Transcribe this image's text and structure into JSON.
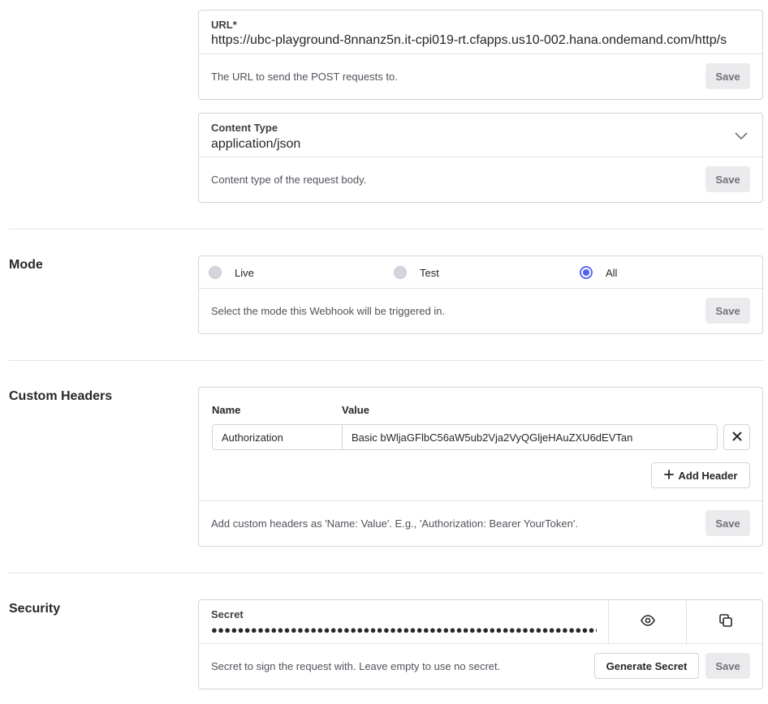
{
  "url": {
    "label": "URL*",
    "value": "https://ubc-playground-8nnanz5n.it-cpi019-rt.cfapps.us10-002.hana.ondemand.com/http/s",
    "help": "The URL to send the POST requests to.",
    "save_label": "Save"
  },
  "content_type": {
    "label": "Content Type",
    "value": "application/json",
    "help": "Content type of the request body.",
    "save_label": "Save",
    "icon": "chevron-down-icon"
  },
  "mode": {
    "title": "Mode",
    "options": [
      {
        "label": "Live",
        "checked": false
      },
      {
        "label": "Test",
        "checked": false
      },
      {
        "label": "All",
        "checked": true
      }
    ],
    "help": "Select the mode this Webhook will be triggered in.",
    "save_label": "Save",
    "accent": "#4f5ff0"
  },
  "custom_headers": {
    "title": "Custom Headers",
    "name_header": "Name",
    "value_header": "Value",
    "rows": [
      {
        "name": "Authorization",
        "value": "Basic bWljaGFlbC56aW5ub2Vja2VyQGljeHAuZXU6dEVTan"
      }
    ],
    "add_label": "Add Header",
    "help": "Add custom headers as 'Name: Value'. E.g., 'Authorization: Bearer YourToken'.",
    "save_label": "Save"
  },
  "security": {
    "title": "Security",
    "secret_label": "Secret",
    "secret_masked": "●●●●●●●●●●●●●●●●●●●●●●●●●●●●●●●●●●●●●●●●●●●●●●●●●●●●●●●●●●●●●●●●",
    "help": "Secret to sign the request with. Leave empty to use no secret.",
    "generate_label": "Generate Secret",
    "save_label": "Save",
    "icons": [
      "eye-icon",
      "copy-icon"
    ]
  }
}
